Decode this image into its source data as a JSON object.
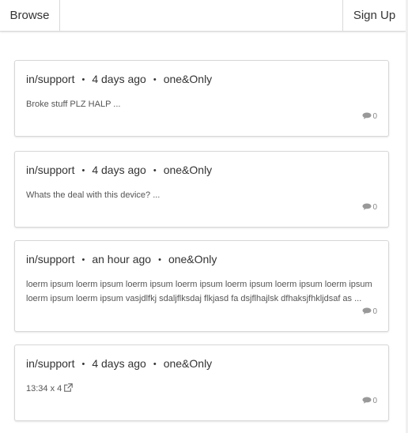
{
  "navbar": {
    "browse_label": "Browse",
    "signup_label": "Sign Up"
  },
  "posts": [
    {
      "community": "in/support",
      "time": "4 days ago",
      "author": "one&Only",
      "body": "Broke stuff PLZ HALP ...",
      "comments": "0"
    },
    {
      "community": "in/support",
      "time": "4 days ago",
      "author": "one&Only",
      "body": "Whats the deal with this device? ...",
      "comments": "0"
    },
    {
      "community": "in/support",
      "time": "an hour ago",
      "author": "one&Only",
      "body": "loerm ipsum loerm ipsum loerm ipsum loerm ipsum loerm ipsum loerm ipsum loerm ipsum loerm ipsum loerm ipsum vasjdlfkj sdaljflksdaj flkjasd fa dsjflhajlsk dfhaksjfhkljdsaf as ...",
      "comments": "0"
    },
    {
      "community": "in/support",
      "time": "4 days ago",
      "author": "one&Only",
      "body": "13:34 x 4",
      "comments": "0",
      "link_icon": "external-link-icon"
    }
  ],
  "icons": {
    "comment": "comment-bubble-icon",
    "external_link": "external-link-icon"
  },
  "colors": {
    "text": "#333333",
    "muted": "#888888",
    "border": "#d7d7d7"
  }
}
